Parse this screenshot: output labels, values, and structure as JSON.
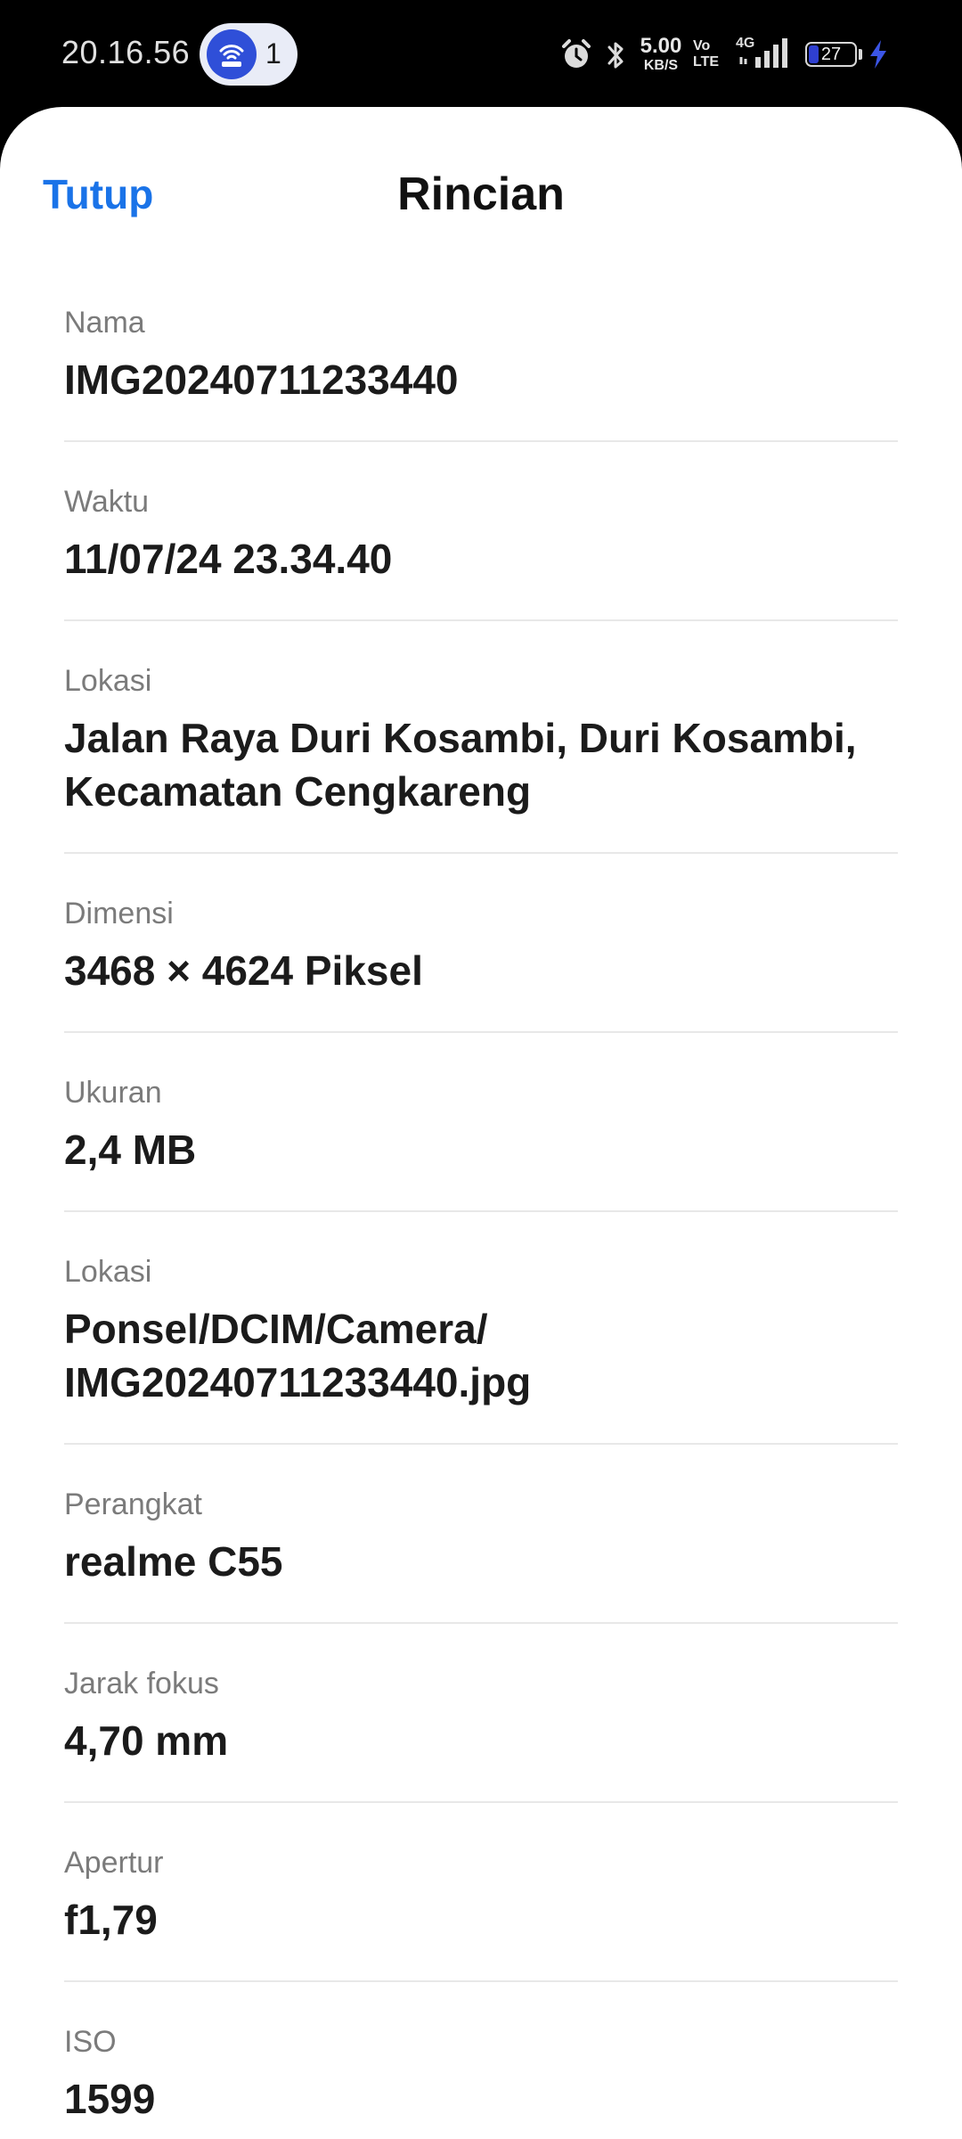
{
  "status_bar": {
    "time": "20.16.56",
    "hotspot_count": "1",
    "net_speed_value": "5.00",
    "net_speed_unit": "KB/S",
    "volte_top": "Vo",
    "volte_bottom": "LTE",
    "network_type": "4G",
    "battery_level": "27",
    "battery_percent": 27,
    "icons": [
      "hotspot-icon",
      "alarm-icon",
      "bluetooth-icon",
      "signal-icon",
      "battery-icon",
      "charging-bolt-icon"
    ],
    "accent_color": "#2f4fd8"
  },
  "header": {
    "close_label": "Tutup",
    "title": "Rincian",
    "close_color": "#1a73e8"
  },
  "details": [
    {
      "label": "Nama",
      "value": "IMG20240711233440"
    },
    {
      "label": "Waktu",
      "value": "11/07/24 23.34.40"
    },
    {
      "label": "Lokasi",
      "value": "Jalan Raya Duri Kosambi, Duri Kosambi, Kecamatan Cengkareng"
    },
    {
      "label": "Dimensi",
      "value": "3468 × 4624 Piksel"
    },
    {
      "label": "Ukuran",
      "value": "2,4 MB"
    },
    {
      "label": "Lokasi",
      "value": "Ponsel/DCIM/Camera/ IMG20240711233440.jpg"
    },
    {
      "label": "Perangkat",
      "value": "realme C55"
    },
    {
      "label": "Jarak fokus",
      "value": "4,70 mm"
    },
    {
      "label": "Apertur",
      "value": "f1,79"
    },
    {
      "label": "ISO",
      "value": "1599"
    }
  ]
}
